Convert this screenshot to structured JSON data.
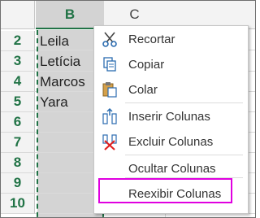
{
  "sheet": {
    "columns": [
      "B",
      "C"
    ],
    "rows": [
      "2",
      "3",
      "4",
      "5",
      "6",
      "7",
      "8",
      "9",
      "10"
    ],
    "cells": [
      "Leila",
      "Letícia",
      "Marcos",
      "Yara"
    ]
  },
  "context_menu": {
    "items": [
      {
        "label": "Recortar",
        "icon": "scissors-icon"
      },
      {
        "label": "Copiar",
        "icon": "copy-icon"
      },
      {
        "label": "Colar",
        "icon": "paste-icon"
      },
      {
        "label": "Inserir Colunas",
        "icon": "insert-columns-icon"
      },
      {
        "label": "Excluir Colunas",
        "icon": "delete-columns-icon"
      },
      {
        "label": "Ocultar Colunas",
        "icon": ""
      },
      {
        "label": "Reexibir Colunas",
        "icon": ""
      }
    ]
  },
  "colors": {
    "excel_green": "#217346",
    "highlight_magenta": "#e000e0"
  }
}
